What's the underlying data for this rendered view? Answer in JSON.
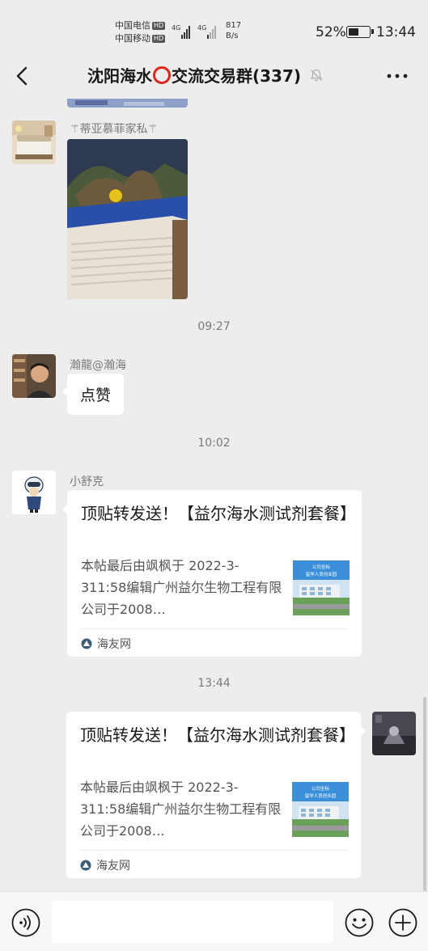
{
  "status_bar": {
    "carrier1": "中国电信",
    "carrier2": "中国移动",
    "hd": "HD",
    "net_type": "4G",
    "net_speed_value": "817",
    "net_speed_unit": "B/s",
    "battery_pct": "52%",
    "battery_level": 0.52,
    "time": "13:44"
  },
  "nav": {
    "title_part1": "沈阳海水",
    "title_icon": "red-circle-icon",
    "title_part2": "交流交易群(337)",
    "muted_icon": "bell-off-icon",
    "back_icon": "back-chevron-icon",
    "more_icon": "more-dots-icon"
  },
  "messages": {
    "m1": {
      "sender": "⚚蒂亚慕菲家私⚚"
    },
    "t1": "09:27",
    "m2": {
      "sender": "瀚龍@瀚海",
      "text": "点赞"
    },
    "t2": "10:02",
    "m3": {
      "sender": "小舒克",
      "card_title": "顶贴转发送！【益尔海水测试剂套餐】",
      "card_desc": "本帖最后由飒枫于 2022-3-311:58编辑广州益尔生物工程有限公司于2008…",
      "card_thumb_line1": "公司坐标",
      "card_thumb_line2": "留学人员创业园",
      "card_source": "海友网"
    },
    "t3": "13:44",
    "m4": {
      "card_title": "顶贴转发送！【益尔海水测试剂套餐】",
      "card_desc": "本帖最后由飒枫于 2022-3-311:58编辑广州益尔生物工程有限公司于2008…",
      "card_thumb_line1": "公司坐标",
      "card_thumb_line2": "留学人员创业园",
      "card_source": "海友网"
    }
  },
  "input_bar": {
    "text_value": "",
    "voice_icon": "voice-icon",
    "emoji_icon": "emoji-icon",
    "plus_icon": "plus-circle-icon"
  },
  "colors": {
    "chat_bg": "#ededed",
    "bubble_bg": "#ffffff",
    "title_circle": "#e2231a"
  }
}
